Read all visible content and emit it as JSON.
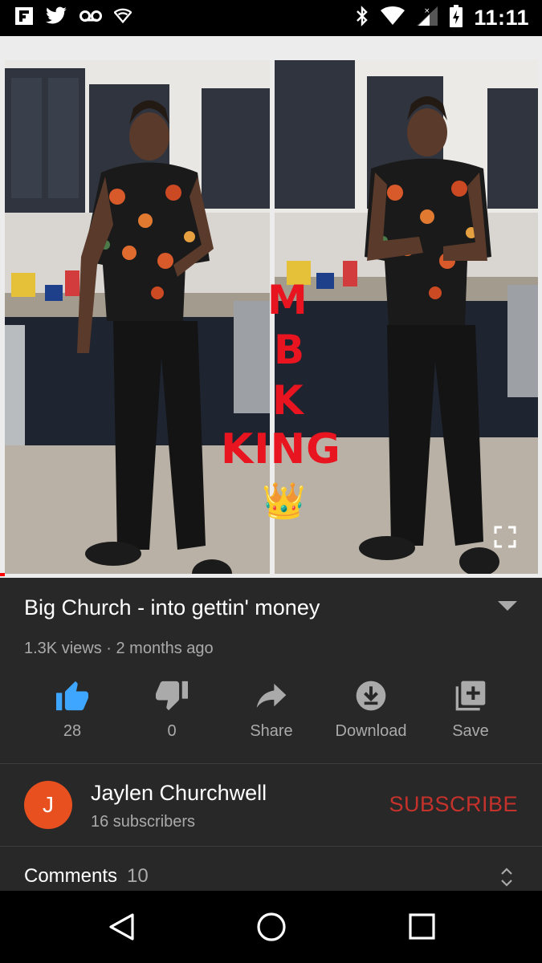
{
  "status_bar": {
    "time": "11:11",
    "left_icons": [
      "flipboard-icon",
      "twitter-icon",
      "voicemail-icon",
      "wifi-hotspot-icon"
    ],
    "right_icons": [
      "bluetooth-icon",
      "wifi-icon",
      "signal-icon",
      "battery-icon"
    ]
  },
  "video": {
    "overlay_text": [
      "M",
      "B",
      "K",
      "KING"
    ],
    "overlay_emoji": "👑",
    "progress_fraction": 0.01
  },
  "details": {
    "title": "Big Church - into gettin' money",
    "meta": "1.3K views · 2 months ago"
  },
  "actions": [
    {
      "label": "28",
      "icon": "thumbs-up-icon"
    },
    {
      "label": "0",
      "icon": "thumbs-down-icon"
    },
    {
      "label": "Share",
      "icon": "share-icon"
    },
    {
      "label": "Download",
      "icon": "download-icon"
    },
    {
      "label": "Save",
      "icon": "save-playlist-icon"
    }
  ],
  "channel": {
    "avatar_letter": "J",
    "name": "Jaylen Churchwell",
    "subscribers": "16 subscribers",
    "subscribe_label": "SUBSCRIBE"
  },
  "comments": {
    "label": "Comments",
    "count": "10"
  },
  "colors": {
    "accent_like": "#3ea6ff",
    "subscribe": "#c5322b",
    "avatar": "#e8501f",
    "overlay_text": "#e8141f"
  }
}
